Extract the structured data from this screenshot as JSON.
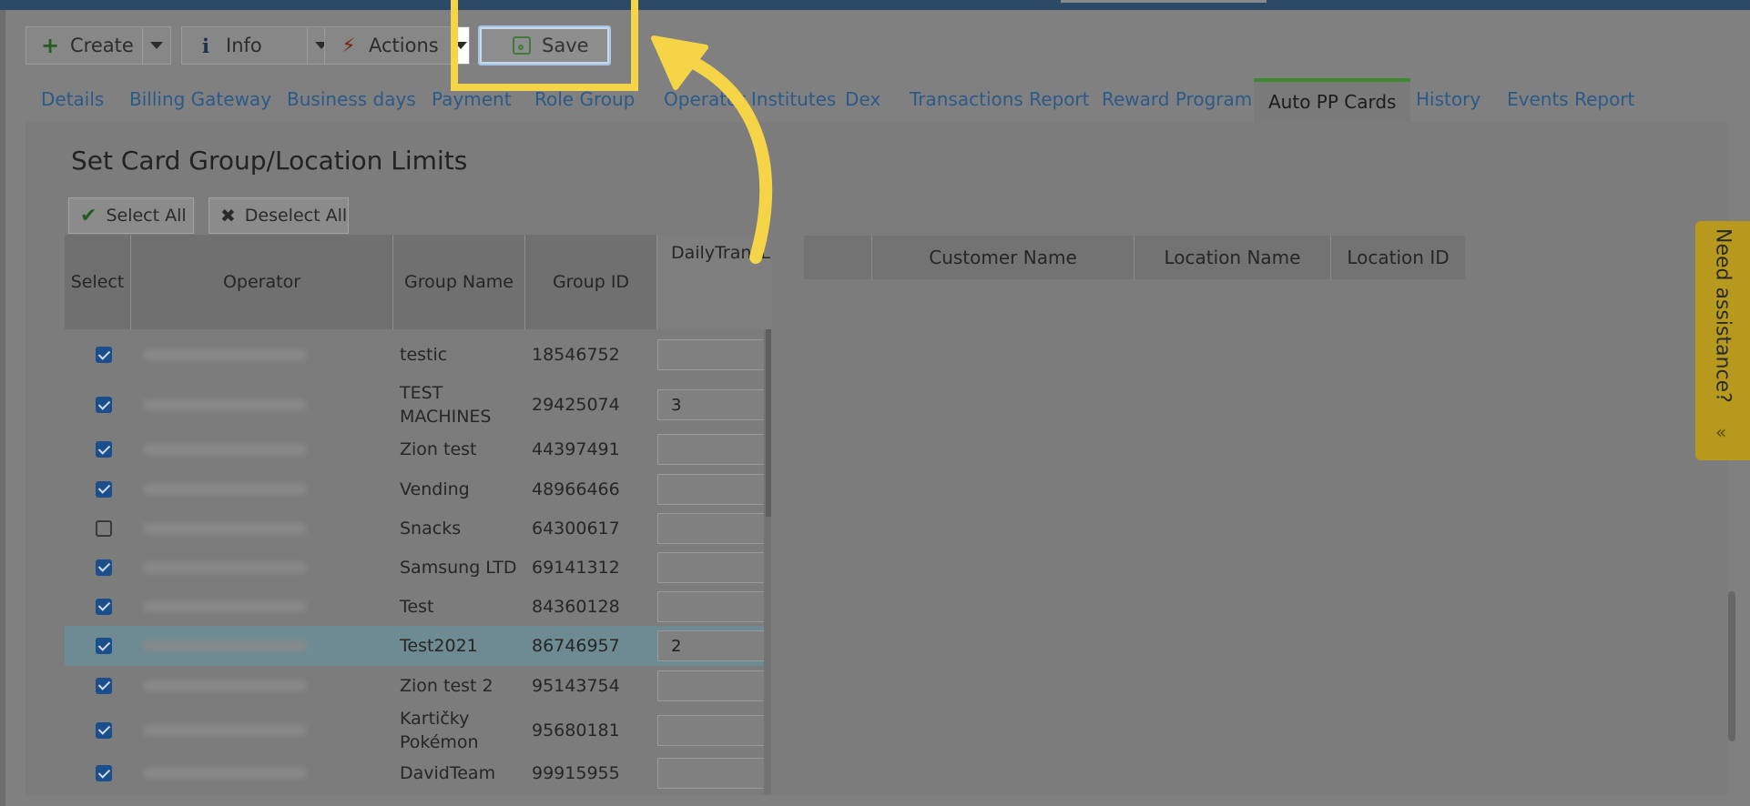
{
  "toolbar": {
    "create": "Create",
    "info": "Info",
    "actions": "Actions",
    "save": "Save"
  },
  "tabs": [
    {
      "label": "Details"
    },
    {
      "label": "Billing Gateway"
    },
    {
      "label": "Business days"
    },
    {
      "label": "Payment"
    },
    {
      "label": "Role Group"
    },
    {
      "label": "Operator Institutes"
    },
    {
      "label": "Dex"
    },
    {
      "label": "Transactions Report"
    },
    {
      "label": "Reward Program"
    },
    {
      "label": "Auto PP Cards"
    },
    {
      "label": "History"
    },
    {
      "label": "Events Report"
    }
  ],
  "panel": {
    "title": "Set Card Group/Location Limits",
    "select_all": "Select All",
    "deselect_all": "Deselect All"
  },
  "grid": {
    "headers": {
      "select": "Select",
      "operator": "Operator",
      "group_name": "Group Name",
      "group_id": "Group ID",
      "limit_l1": "Daily",
      "limit_l2": "Trans",
      "limit_l3": "Limit"
    },
    "rows": [
      {
        "checked": true,
        "name_l1": "testic",
        "name_l2": "",
        "id": "18546752",
        "limit": ""
      },
      {
        "checked": true,
        "name_l1": "TEST",
        "name_l2": "MACHINES",
        "id": "29425074",
        "limit": "3"
      },
      {
        "checked": true,
        "name_l1": "Zion test",
        "name_l2": "",
        "id": "44397491",
        "limit": ""
      },
      {
        "checked": true,
        "name_l1": "Vending",
        "name_l2": "",
        "id": "48966466",
        "limit": ""
      },
      {
        "checked": false,
        "name_l1": "Snacks",
        "name_l2": "",
        "id": "64300617",
        "limit": ""
      },
      {
        "checked": true,
        "name_l1": "Samsung LTD",
        "name_l2": "",
        "id": "69141312",
        "limit": ""
      },
      {
        "checked": true,
        "name_l1": "Test",
        "name_l2": "",
        "id": "84360128",
        "limit": ""
      },
      {
        "checked": true,
        "name_l1": "Test2021",
        "name_l2": "",
        "id": "86746957",
        "limit": "2"
      },
      {
        "checked": true,
        "name_l1": "Zion test 2",
        "name_l2": "",
        "id": "95143754",
        "limit": ""
      },
      {
        "checked": true,
        "name_l1": "Kartičky",
        "name_l2": "Pokémon",
        "id": "95680181",
        "limit": ""
      },
      {
        "checked": true,
        "name_l1": "DavidTeam",
        "name_l2": "",
        "id": "99915955",
        "limit": ""
      }
    ]
  },
  "right_grid": {
    "customer_name": "Customer Name",
    "location_name": "Location Name",
    "location_id": "Location ID"
  },
  "assistance": {
    "label": "Need assistance?"
  },
  "colors": {
    "highlight": "#f5d547",
    "tab_link": "#2b5a8a",
    "checkbox": "#1a4f8c"
  }
}
